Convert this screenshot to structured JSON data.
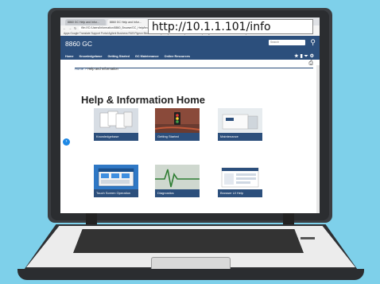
{
  "browser": {
    "tabs": [
      "8860 GC Help and Infor...",
      "8860 GC Help and Infor..."
    ],
    "address": "file:///C:/Users/Information/8860_Browse/GC_Help/browser-ui/help/en/output/8860/index.html#Information.htm",
    "bookmarks": "Apps  Google Translate  Support Portal  Agilent Business  RUB  Pigeon  Blockchain Project  System Block System  JavaScript  Pager: Chart Shere  Character Entity Ref",
    "url_callout": "http://10.1.1.101/info"
  },
  "app": {
    "title": "8860 GC",
    "search_placeholder": "Search",
    "nav": [
      "Home",
      "Knowledgebase",
      "Getting Started",
      "GC Maintenance",
      "Online Resources"
    ],
    "breadcrumb_home": "Home",
    "breadcrumb_sep": " > ",
    "breadcrumb_current": "Help and Information",
    "page_title": "Help & Information Home"
  },
  "cards": [
    {
      "label": "Knowledgebase"
    },
    {
      "label": "Getting Started"
    },
    {
      "label": "Maintenance"
    },
    {
      "label": "Touch Screen Operation"
    },
    {
      "label": "Diagnostics"
    },
    {
      "label": "Browser UI Help"
    }
  ],
  "icons": {
    "search": "search-icon",
    "star": "star-icon",
    "bookmark": "bookmark-icon",
    "filter": "filter-icon",
    "settings": "settings-icon",
    "print": "print-icon",
    "arrow": "arrow-right-icon"
  },
  "colors": {
    "brand": "#2c4f7c",
    "background": "#7ed0ea",
    "accent": "#1e88e5"
  }
}
